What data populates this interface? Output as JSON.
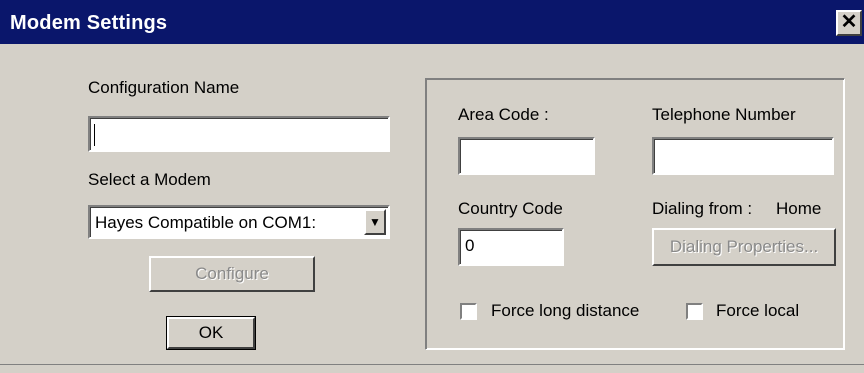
{
  "window": {
    "title": "Modem Settings",
    "close_symbol": "✕"
  },
  "config": {
    "label": "Configuration Name",
    "value": ""
  },
  "modem": {
    "label": "Select a Modem",
    "selected": "Hayes Compatible on COM1:"
  },
  "buttons": {
    "configure": "Configure",
    "ok": "OK",
    "dialing_properties": "Dialing Properties..."
  },
  "dialing": {
    "area_code_label": "Area Code :",
    "area_code_value": "",
    "telephone_label": "Telephone Number",
    "telephone_value": "",
    "country_code_label": "Country Code",
    "country_code_value": "0",
    "dialing_from_label": "Dialing from :",
    "dialing_from_value": "Home",
    "force_long_distance_label": "Force long distance",
    "force_local_label": "Force local",
    "force_long_distance_checked": false,
    "force_local_checked": false
  }
}
